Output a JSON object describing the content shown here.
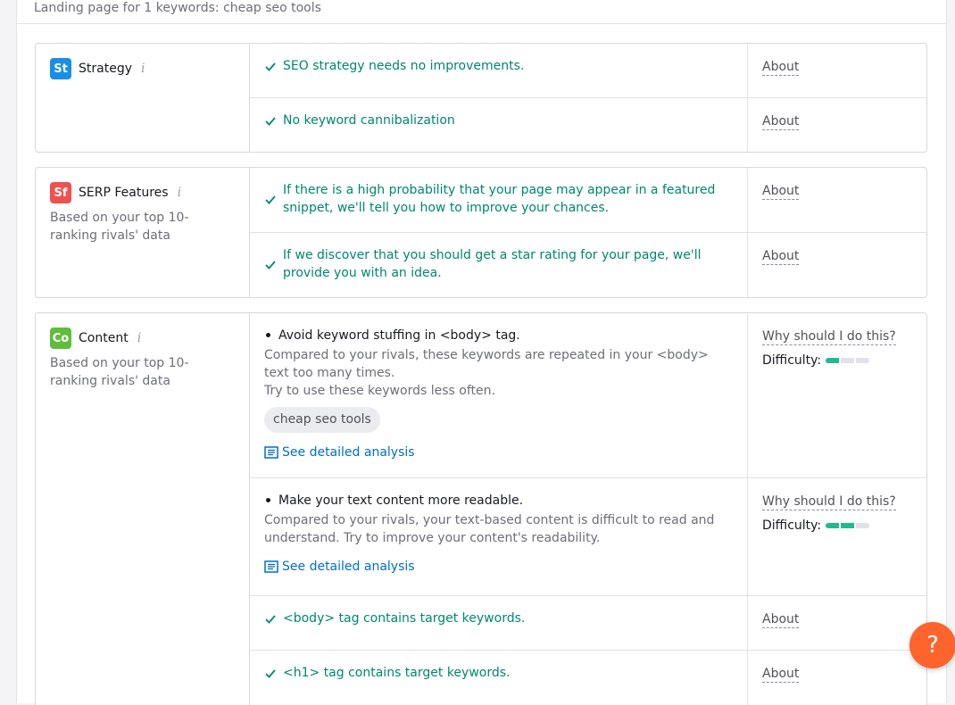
{
  "header": {
    "landing_text": "Landing page for 1 keywords: cheap seo tools"
  },
  "sections": {
    "strategy": {
      "badge": "St",
      "badge_color": "#1a8ee6",
      "title": "Strategy",
      "info": "i",
      "rows": [
        {
          "text": "SEO strategy needs no improvements.",
          "side": "About"
        },
        {
          "text": "No keyword cannibalization",
          "side": "About"
        }
      ]
    },
    "serp": {
      "badge": "Sf",
      "badge_color": "#f05050",
      "title": "SERP Features",
      "info": "i",
      "desc": "Based on your top 10-ranking rivals' data",
      "rows": [
        {
          "text": "If there is a high probability that your page may appear in a featured snippet, we'll tell you how to improve your chances.",
          "side": "About"
        },
        {
          "text": "If we discover that you should get a star rating for your page, we'll provide you with an idea.",
          "side": "About"
        }
      ]
    },
    "content": {
      "badge": "Co",
      "badge_color": "#60bd3c",
      "title": "Content",
      "info": "i",
      "desc": "Based on your top 10-ranking rivals' data",
      "recs": [
        {
          "title": "Avoid keyword stuffing in <body> tag.",
          "desc1": "Compared to your rivals, these keywords are repeated in your <body> text too many times.",
          "desc2": "Try to use these keywords less often.",
          "chip": "cheap seo tools",
          "link": "See detailed analysis",
          "why": "Why should I do this?",
          "difficulty_label": "Difficulty:",
          "difficulty_level": 1
        },
        {
          "title": "Make your text content more readable.",
          "desc1": "Compared to your rivals, your text-based content is difficult to read and understand. Try to improve your content's readability.",
          "link": "See detailed analysis",
          "why": "Why should I do this?",
          "difficulty_label": "Difficulty:",
          "difficulty_level": 2
        }
      ],
      "rows": [
        {
          "text": "<body> tag contains target keywords.",
          "side": "About"
        },
        {
          "text": "<h1> tag contains target keywords.",
          "side": "About"
        }
      ]
    }
  },
  "help": {
    "label": "?"
  },
  "colors": {
    "ok_green": "#00876a",
    "link_blue": "#006dca",
    "difficulty_fill": "#1ebc8f",
    "help_orange": "#ff642d"
  }
}
